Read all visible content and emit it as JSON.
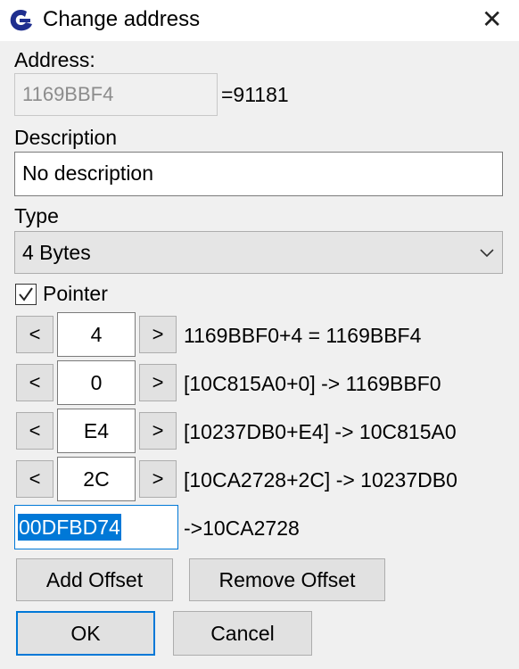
{
  "window": {
    "title": "Change address",
    "close_label": "✕"
  },
  "address": {
    "label": "Address:",
    "value": "1169BBF4",
    "resolved": "=91181"
  },
  "description": {
    "label": "Description",
    "value": "No description"
  },
  "type": {
    "label": "Type",
    "selected": "4 Bytes"
  },
  "pointer": {
    "label": "Pointer",
    "checked": true,
    "offsets": [
      {
        "offset": "4",
        "expression": "1169BBF0+4 = 1169BBF4"
      },
      {
        "offset": "0",
        "expression": "[10C815A0+0] -> 1169BBF0"
      },
      {
        "offset": "E4",
        "expression": "[10237DB0+E4] -> 10C815A0"
      },
      {
        "offset": "2C",
        "expression": "[10CA2728+2C] -> 10237DB0"
      }
    ],
    "base_address": "00DFBD74",
    "base_result": "->10CA2728",
    "decrease_label": "<",
    "increase_label": ">"
  },
  "buttons": {
    "add_offset": "Add Offset",
    "remove_offset": "Remove Offset",
    "ok": "OK",
    "cancel": "Cancel"
  },
  "colors": {
    "accent": "#0078d7",
    "brand_icon": "#1f2f8f"
  }
}
